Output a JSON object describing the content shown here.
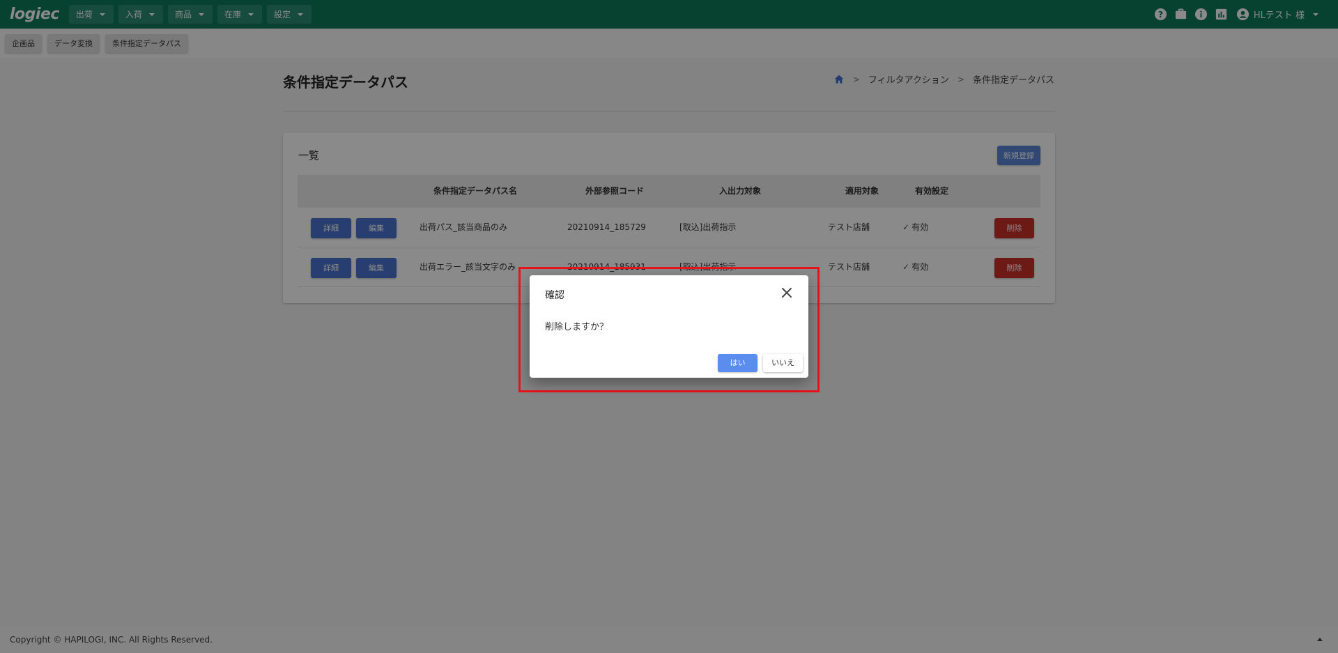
{
  "app": {
    "logo": "logiec",
    "nav": [
      "出荷",
      "入荷",
      "商品",
      "在庫",
      "設定"
    ],
    "user": "HLテスト 様",
    "top_icons": [
      "help-icon",
      "briefcase-icon",
      "info-icon",
      "chart-icon",
      "account-icon"
    ]
  },
  "subnav": [
    "企画品",
    "データ変換",
    "条件指定データパス"
  ],
  "page": {
    "title": "条件指定データパス",
    "breadcrumb": [
      "フィルタアクション",
      "条件指定データパス"
    ]
  },
  "list": {
    "title": "一覧",
    "new_button": "新規登録",
    "columns": [
      "条件指定データパス名",
      "外部参照コード",
      "入出力対象",
      "適用対象",
      "有効設定"
    ],
    "row_buttons": {
      "detail": "詳細",
      "edit": "編集",
      "delete": "削除"
    },
    "rows": [
      {
        "name": "出荷パス_該当商品のみ",
        "code": "20210914_185729",
        "target": "[取込]出荷指示",
        "applies_to": "テスト店舗",
        "enabled": "有効"
      },
      {
        "name": "出荷エラー_該当文字のみ",
        "code": "20210914_185931",
        "target": "[取込]出荷指示",
        "applies_to": "テスト店舗",
        "enabled": "有効"
      }
    ]
  },
  "footer": {
    "copyright": "Copyright © HAPILOGI, INC. All Rights Reserved."
  },
  "dialog": {
    "title": "確認",
    "message": "削除しますか？",
    "yes": "はい",
    "no": "いいえ"
  },
  "colors": {
    "header": "#0d7a5c",
    "primary": "#4a72d0",
    "danger": "#c9302c",
    "highlight": "#e8141c"
  }
}
